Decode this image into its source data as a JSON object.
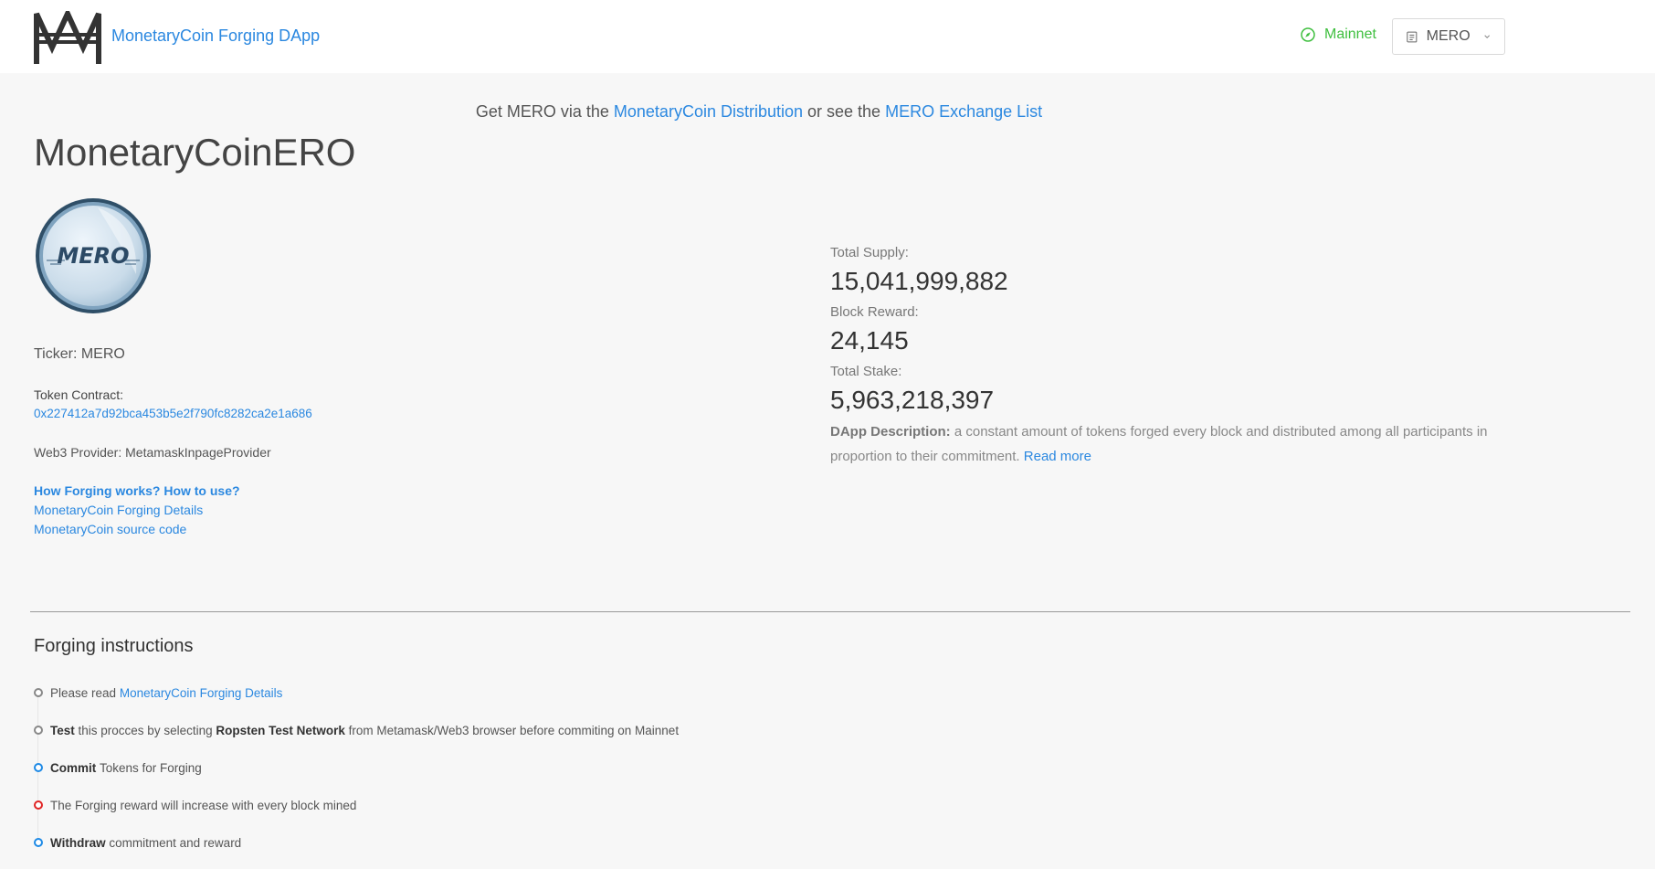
{
  "header": {
    "app_title": "MonetaryCoin Forging DApp",
    "network": "Mainnet",
    "token_select": "MERO",
    "network_color": "#3fbf3f",
    "link_color": "#2b88e0"
  },
  "promo": {
    "prefix": "Get MERO via the",
    "distribution_link": "MonetaryCoin Distribution",
    "middle": "or see the",
    "exchange_link": "MERO Exchange List"
  },
  "token": {
    "name": "MonetaryCoinERO",
    "coin_label": "MERO",
    "ticker": "Ticker: MERO",
    "contract_label": "Token Contract:",
    "contract_address": "0x227412a7d92bca453b5e2f790fc8282ca2e1a686",
    "web3_provider": "Web3 Provider: MetamaskInpageProvider",
    "howto_link": "How Forging works? How to use?",
    "details_link": "MonetaryCoin Forging Details",
    "source_link": "MonetaryCoin source code"
  },
  "stats": {
    "total_supply_label": "Total Supply:",
    "total_supply": "15,041,999,882",
    "block_reward_label": "Block Reward:",
    "block_reward": "24,145",
    "total_stake_label": "Total Stake:",
    "total_stake": "5,963,218,397",
    "description_label": "DApp Description:",
    "description": "a constant amount of tokens forged every block and distributed among all participants in proportion to their commitment.",
    "read_more": "Read more"
  },
  "instructions": {
    "title": "Forging instructions",
    "step1_text": "Please read",
    "step1_link": "MonetaryCoin Forging Details",
    "step2_bold1": "Test",
    "step2_text1": "this procces by selecting",
    "step2_bold2": "Ropsten Test Network",
    "step2_text2": "from Metamask/Web3 browser before commiting on Mainnet",
    "step3_bold": "Commit",
    "step3_text": "Tokens for Forging",
    "step4_text": "The Forging reward will increase with every block mined",
    "step5_bold": "Withdraw",
    "step5_text": "commitment and reward"
  }
}
